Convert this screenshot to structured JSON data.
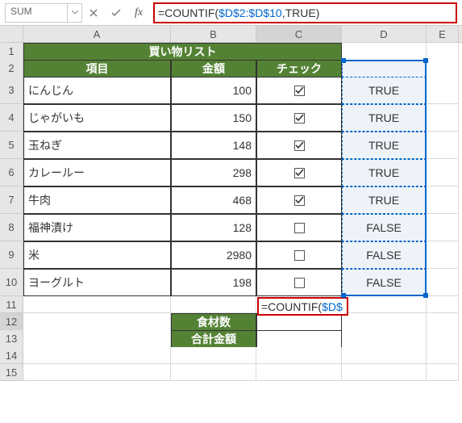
{
  "nameBox": "SUM",
  "formula_prefix": "=COUNTIF(",
  "formula_ref": "$D$2:$D$10",
  "formula_mid": ",TRUE)",
  "columns": [
    "A",
    "B",
    "C",
    "D",
    "E"
  ],
  "title": "買い物リスト",
  "headers": {
    "item": "項目",
    "amount": "金額",
    "check": "チェック"
  },
  "items": [
    {
      "name": "にんじん",
      "amount": "100",
      "checked": true,
      "linked": "TRUE"
    },
    {
      "name": "じゃがいも",
      "amount": "150",
      "checked": true,
      "linked": "TRUE"
    },
    {
      "name": "玉ねぎ",
      "amount": "148",
      "checked": true,
      "linked": "TRUE"
    },
    {
      "name": "カレールー",
      "amount": "298",
      "checked": true,
      "linked": "TRUE"
    },
    {
      "name": "牛肉",
      "amount": "468",
      "checked": true,
      "linked": "TRUE"
    },
    {
      "name": "福神漬け",
      "amount": "128",
      "checked": false,
      "linked": "FALSE"
    },
    {
      "name": "米",
      "amount": "2980",
      "checked": false,
      "linked": "FALSE"
    },
    {
      "name": "ヨーグルト",
      "amount": "198",
      "checked": false,
      "linked": "FALSE"
    }
  ],
  "summary": {
    "countLabel": "食材数",
    "totalLabel": "合計金額"
  },
  "editing": {
    "display_prefix": "=COUNTIF(",
    "display_ref": "$D$"
  },
  "rowNums": [
    "1",
    "2",
    "3",
    "4",
    "5",
    "6",
    "7",
    "8",
    "9",
    "10",
    "11",
    "12",
    "13",
    "14",
    "15"
  ]
}
